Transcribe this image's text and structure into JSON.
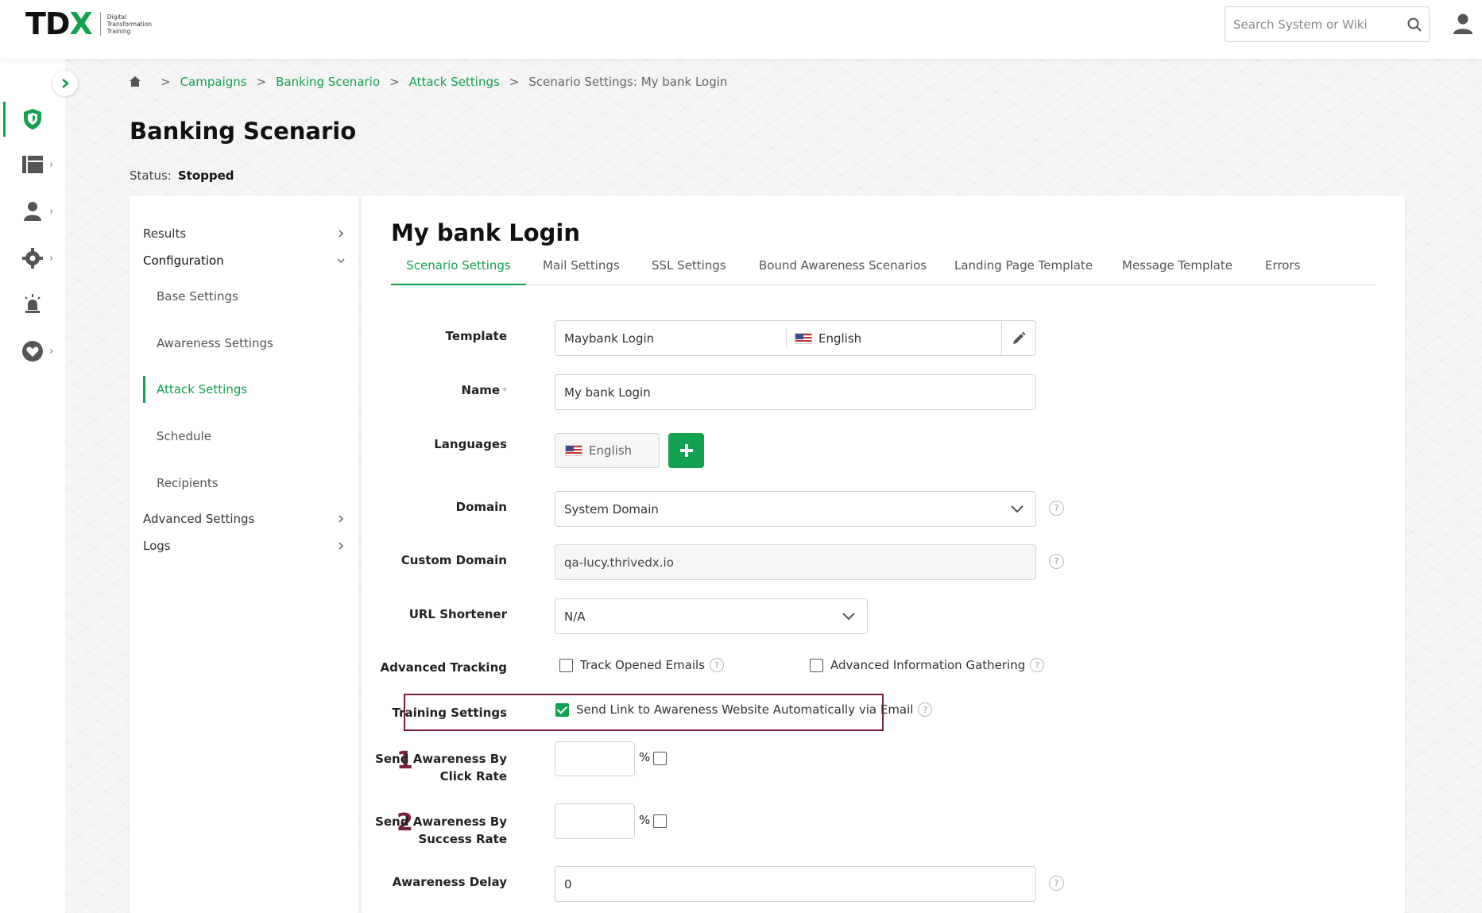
{
  "header": {
    "logo_main": "TD",
    "logo_x": "X",
    "logo_sub_1": "Digital",
    "logo_sub_2": "Transformation",
    "logo_sub_3": "Training",
    "search_placeholder": "Search System or Wiki"
  },
  "breadcrumb": {
    "sep": ">",
    "items": [
      "Campaigns",
      "Banking Scenario",
      "Attack Settings"
    ],
    "current": "Scenario Settings: My bank Login"
  },
  "page": {
    "title": "Banking Scenario",
    "status_label": "Status:",
    "status_value": "Stopped"
  },
  "left_nav": {
    "results": "Results",
    "configuration": "Configuration",
    "sub_items": [
      "Base Settings",
      "Awareness Settings",
      "Attack Settings",
      "Schedule",
      "Recipients"
    ],
    "advanced_settings": "Advanced Settings",
    "logs": "Logs"
  },
  "card": {
    "title": "My bank Login",
    "tabs": [
      "Scenario Settings",
      "Mail Settings",
      "SSL Settings",
      "Bound Awareness Scenarios",
      "Landing Page Template",
      "Message Template",
      "Errors"
    ],
    "active_tab": "Scenario Settings"
  },
  "form": {
    "template_label": "Template",
    "template_value": "Maybank Login",
    "template_language": "English",
    "name_label": "Name",
    "name_required": "*",
    "name_value": "My bank Login",
    "languages_label": "Languages",
    "languages_value": "English",
    "domain_label": "Domain",
    "domain_value": "System Domain",
    "custom_domain_label": "Custom Domain",
    "custom_domain_value": "qa-lucy.thrivedx.io",
    "url_shortener_label": "URL Shortener",
    "url_shortener_value": "N/A",
    "advanced_tracking_label": "Advanced Tracking",
    "track_opened": "Track Opened Emails",
    "advanced_info": "Advanced Information Gathering",
    "training_settings_label": "Training Settings",
    "send_link": "Send Link to Awareness Website Automatically via Email",
    "click_rate_label_1": "Send Awareness By",
    "click_rate_label_2": "Click Rate",
    "success_rate_label_1": "Send Awareness By",
    "success_rate_label_2": "Success Rate",
    "percent": "%",
    "awareness_delay_label": "Awareness Delay",
    "awareness_delay_value": "0",
    "help": "?"
  },
  "annotations": {
    "step1": "1",
    "step2": "2"
  },
  "colors": {
    "accent": "#12a150",
    "annotation": "#7b1f42"
  }
}
